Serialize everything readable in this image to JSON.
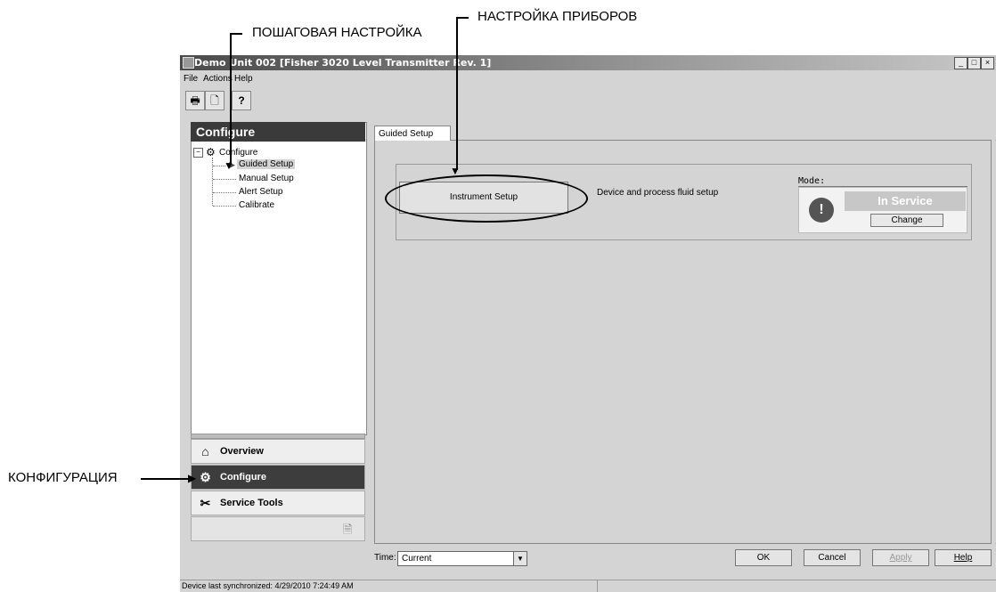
{
  "callouts": {
    "guided_setup": "ПОШАГОВАЯ НАСТРОЙКА",
    "instrument_setup": "НАСТРОЙКА ПРИБОРОВ",
    "configure": "КОНФИГУРАЦИЯ"
  },
  "window": {
    "title": "Demo Unit 002 [Fisher 3020 Level Transmitter Rev. 1]",
    "controls": [
      "_",
      "□",
      "×"
    ]
  },
  "menu": [
    "File",
    "Actions",
    "Help"
  ],
  "toolbar": {
    "icons": [
      "print-icon",
      "print-preview-icon",
      "context-help-icon"
    ],
    "glyphs": [
      "🖶",
      "🗋",
      "?"
    ]
  },
  "left_panel": {
    "header": "Configure",
    "tree": {
      "root": "Configure",
      "items": [
        "Guided Setup",
        "Manual Setup",
        "Alert Setup",
        "Calibrate"
      ]
    },
    "nav": [
      {
        "label": "Overview",
        "icon": "home-icon",
        "glyph": "⌂"
      },
      {
        "label": "Configure",
        "icon": "gear-icon",
        "glyph": "⚙"
      },
      {
        "label": "Service Tools",
        "icon": "tools-icon",
        "glyph": "✂"
      }
    ]
  },
  "main": {
    "tab": "Guided Setup",
    "instrument_button": "Instrument Setup",
    "instrument_desc": "Device and process fluid setup",
    "mode_label": "Mode:",
    "mode_status": "In Service",
    "mode_change": "Change"
  },
  "footer": {
    "time_label": "Time:",
    "time_value": "Current",
    "buttons": [
      "OK",
      "Cancel",
      "Apply",
      "Help"
    ]
  },
  "status": "Device last synchronized: 4/29/2010 7:24:49 AM"
}
